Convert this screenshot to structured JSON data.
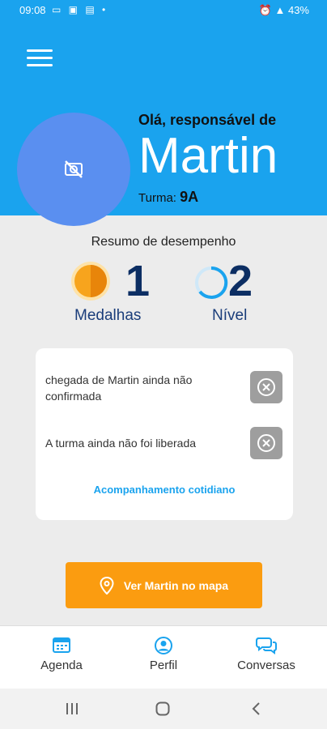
{
  "status_bar": {
    "time": "09:08",
    "battery": "43%"
  },
  "header": {
    "greeting": "Olá, responsável de",
    "student_name": "Martin",
    "class_label": "Turma:",
    "class_value": "9A"
  },
  "summary": {
    "title": "Resumo de desempenho",
    "medals": {
      "value": "1",
      "label": "Medalhas"
    },
    "level": {
      "value": "2",
      "label": "Nível"
    }
  },
  "notices": [
    {
      "text": " chegada de Martin ainda não confirmada"
    },
    {
      "text": "A turma ainda não foi liberada"
    }
  ],
  "daily_link": "Acompanhamento cotidiano",
  "map_button": "Ver Martin no mapa",
  "bottom_nav": [
    {
      "label": "Agenda"
    },
    {
      "label": "Perfil"
    },
    {
      "label": "Conversas"
    }
  ],
  "colors": {
    "primary": "#1aa3ee",
    "accent": "#fb9c10",
    "avatar": "#5a8ff0"
  }
}
